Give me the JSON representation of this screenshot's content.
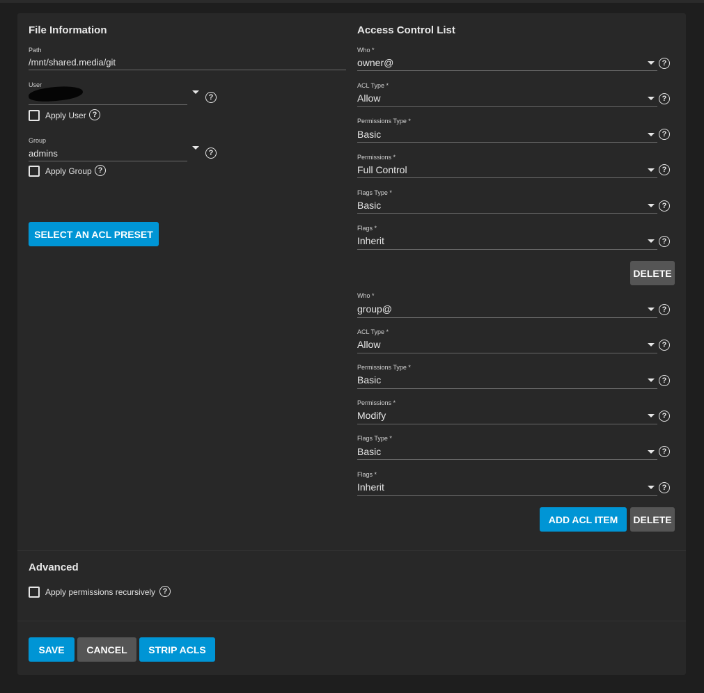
{
  "file_info": {
    "title": "File Information",
    "path_label": "Path",
    "path_value": "/mnt/shared.media/git",
    "user_label": "User",
    "user_value": "",
    "apply_user_label": "Apply User",
    "group_label": "Group",
    "group_value": "admins",
    "apply_group_label": "Apply Group",
    "preset_button": "SELECT AN ACL PRESET"
  },
  "acl": {
    "title": "Access Control List",
    "items": [
      {
        "who_label": "Who *",
        "who": "owner@",
        "type_label": "ACL Type *",
        "type": "Allow",
        "perm_type_label": "Permissions Type *",
        "perm_type": "Basic",
        "perm_label": "Permissions *",
        "perm": "Full Control",
        "flags_type_label": "Flags Type *",
        "flags_type": "Basic",
        "flags_label": "Flags *",
        "flags": "Inherit",
        "delete_label": "DELETE"
      },
      {
        "who_label": "Who *",
        "who": "group@",
        "type_label": "ACL Type *",
        "type": "Allow",
        "perm_type_label": "Permissions Type *",
        "perm_type": "Basic",
        "perm_label": "Permissions *",
        "perm": "Modify",
        "flags_type_label": "Flags Type *",
        "flags_type": "Basic",
        "flags_label": "Flags *",
        "flags": "Inherit",
        "delete_label": "DELETE"
      }
    ],
    "add_button": "ADD ACL ITEM"
  },
  "advanced": {
    "title": "Advanced",
    "recursive_label": "Apply permissions recursively"
  },
  "actions": {
    "save": "SAVE",
    "cancel": "CANCEL",
    "strip": "STRIP ACLS"
  },
  "icons": {
    "help": "help-circle-icon",
    "caret": "caret-down-icon",
    "checkbox": "checkbox-unchecked-icon"
  },
  "colors": {
    "primary": "#0095d5",
    "secondary": "#555555",
    "card": "#282828",
    "background": "#1e1e1e"
  }
}
